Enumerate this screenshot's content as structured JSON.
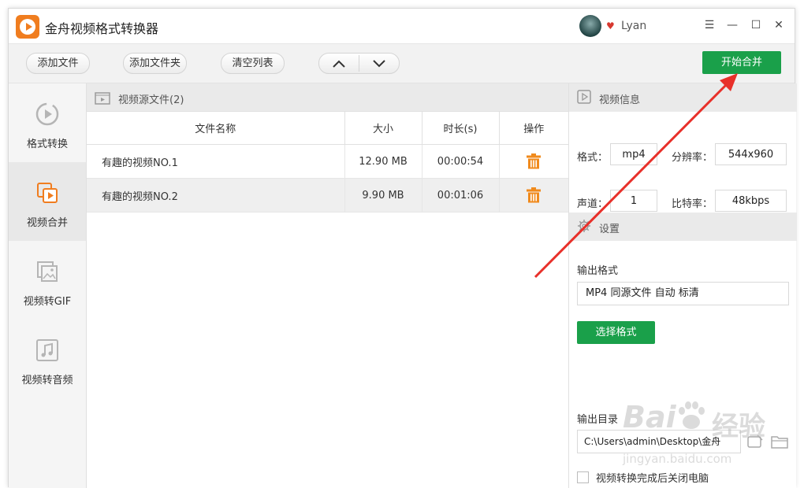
{
  "app": {
    "title": "金舟视频格式转换器",
    "username": "Lyan"
  },
  "window_controls": {
    "menu": "☰",
    "minimize": "—",
    "maximize": "☐",
    "close": "✕"
  },
  "toolbar": {
    "add_file": "添加文件",
    "add_folder": "添加文件夹",
    "clear_list": "清空列表",
    "start_merge": "开始合并"
  },
  "sidebar": {
    "items": [
      {
        "label": "格式转换",
        "icon": "play-circle-icon"
      },
      {
        "label": "视频合并",
        "icon": "merge-video-icon"
      },
      {
        "label": "视频转GIF",
        "icon": "image-icon"
      },
      {
        "label": "视频转音频",
        "icon": "music-note-icon"
      }
    ],
    "active": 1
  },
  "file_list": {
    "title": "视频源文件(2)",
    "columns": [
      "文件名称",
      "大小",
      "时长(s)",
      "操作"
    ],
    "rows": [
      {
        "name": "有趣的视频NO.1",
        "size": "12.90 MB",
        "duration": "00:00:54"
      },
      {
        "name": "有趣的视频NO.2",
        "size": "9.90 MB",
        "duration": "00:01:06"
      }
    ]
  },
  "video_info": {
    "title": "视频信息",
    "format_label": "格式：",
    "format": "mp4",
    "resolution_label": "分辨率：",
    "resolution": "544x960",
    "channels_label": "声道：",
    "channels": "1",
    "bitrate_label": "比特率：",
    "bitrate": "48kbps"
  },
  "settings": {
    "title": "设置",
    "output_format_label": "输出格式",
    "output_format": "MP4 同源文件 自动 标清",
    "choose_format": "选择格式",
    "output_dir_label": "输出目录",
    "output_dir": "C:\\Users\\admin\\Desktop\\金舟",
    "shutdown_label": "视频转换完成后关闭电脑"
  },
  "watermark": {
    "brand": "Bai",
    "suffix": "经验",
    "url": "jingyan.baidu.com"
  },
  "colors": {
    "accent_green": "#1aa04a",
    "brand_orange": "#f07d1f",
    "annotation_red": "#e8302a"
  }
}
